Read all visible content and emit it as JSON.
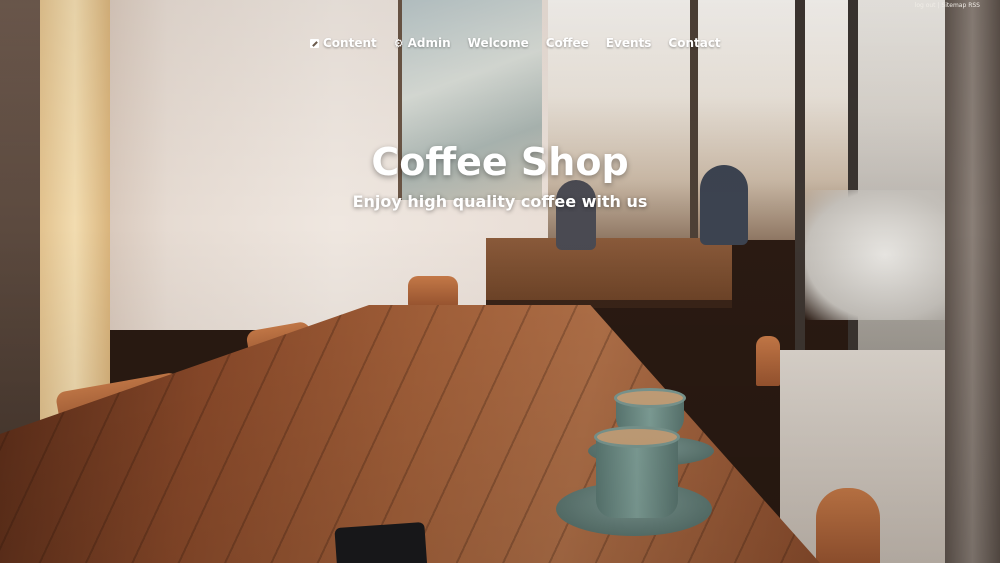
{
  "top_links": {
    "login": "log out",
    "separator": "|",
    "sitemap": "Sitemap",
    "rss": "RSS"
  },
  "nav": {
    "items": [
      {
        "label": "Content",
        "icon": "edit-icon"
      },
      {
        "label": "Admin",
        "icon": "gear-icon"
      },
      {
        "label": "Welcome"
      },
      {
        "label": "Coffee"
      },
      {
        "label": "Events"
      },
      {
        "label": "Contact"
      }
    ]
  },
  "hero": {
    "title": "Coffee Shop",
    "subtitle": "Enjoy high quality coffee with us"
  },
  "colors": {
    "text": "#ffffff",
    "table_wood": "#a4613a",
    "cup": "#6f8f88"
  }
}
